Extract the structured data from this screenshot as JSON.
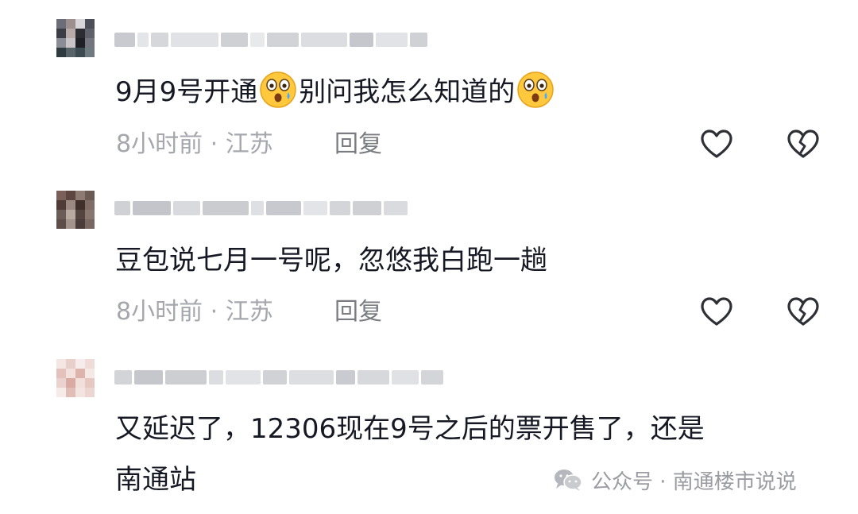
{
  "comments": [
    {
      "text_before": "9月9号开通",
      "text_middle": "别问我怎么知道的",
      "time_location": "8小时前 · 江苏",
      "reply_label": "回复",
      "emoji_icon": "astonished-face-emoji-icon"
    },
    {
      "text": "豆包说七月一号呢，忽悠我白跑一趟",
      "time_location": "8小时前 · 江苏",
      "reply_label": "回复"
    },
    {
      "text_line1": "又延迟了，12306现在9号之后的票开售了，还是",
      "text_line2": "南通站"
    }
  ],
  "watermark": {
    "label": "公众号 · 南通楼市说说",
    "icon": "wechat-icon"
  },
  "icons": {
    "like": "heart-outline-icon",
    "dislike": "broken-heart-icon"
  },
  "colors": {
    "text": "#161823",
    "meta": "#a5a7ad",
    "reply": "#7a7c82",
    "icon": "#2f3036",
    "watermark": "#9a9ca2"
  }
}
